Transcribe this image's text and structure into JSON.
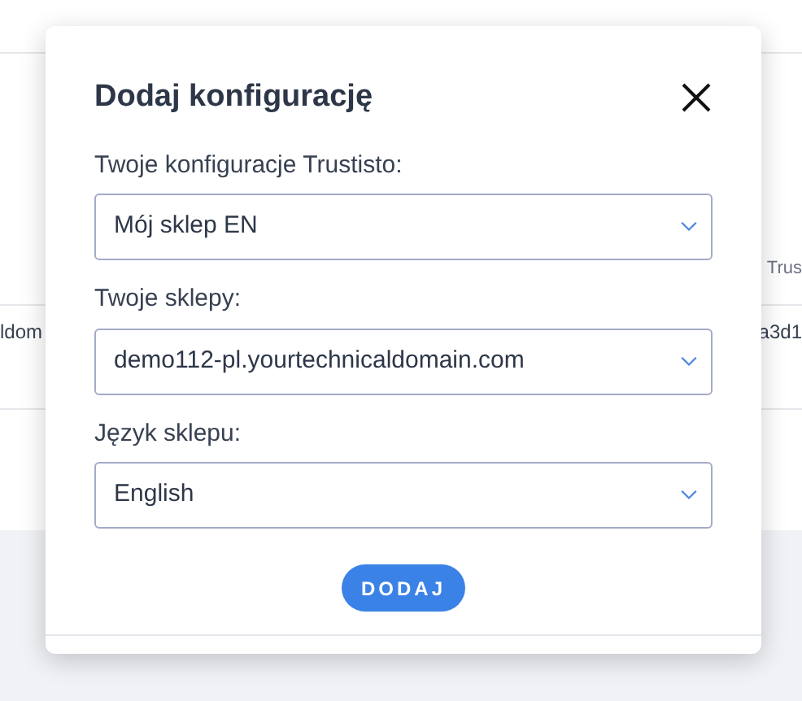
{
  "background": {
    "header_fragment": "Trus",
    "row_left_fragment": "ldom",
    "row_right_fragment": "a3d1"
  },
  "dialog": {
    "title": "Dodaj konfigurację",
    "fields": [
      {
        "label": "Twoje konfiguracje Trustisto:",
        "value": "Mój sklep EN"
      },
      {
        "label": "Twoje sklepy:",
        "value": "demo112-pl.yourtechnicaldomain.com"
      },
      {
        "label": "Język sklepu:",
        "value": "English"
      }
    ],
    "button": "DODAJ"
  }
}
